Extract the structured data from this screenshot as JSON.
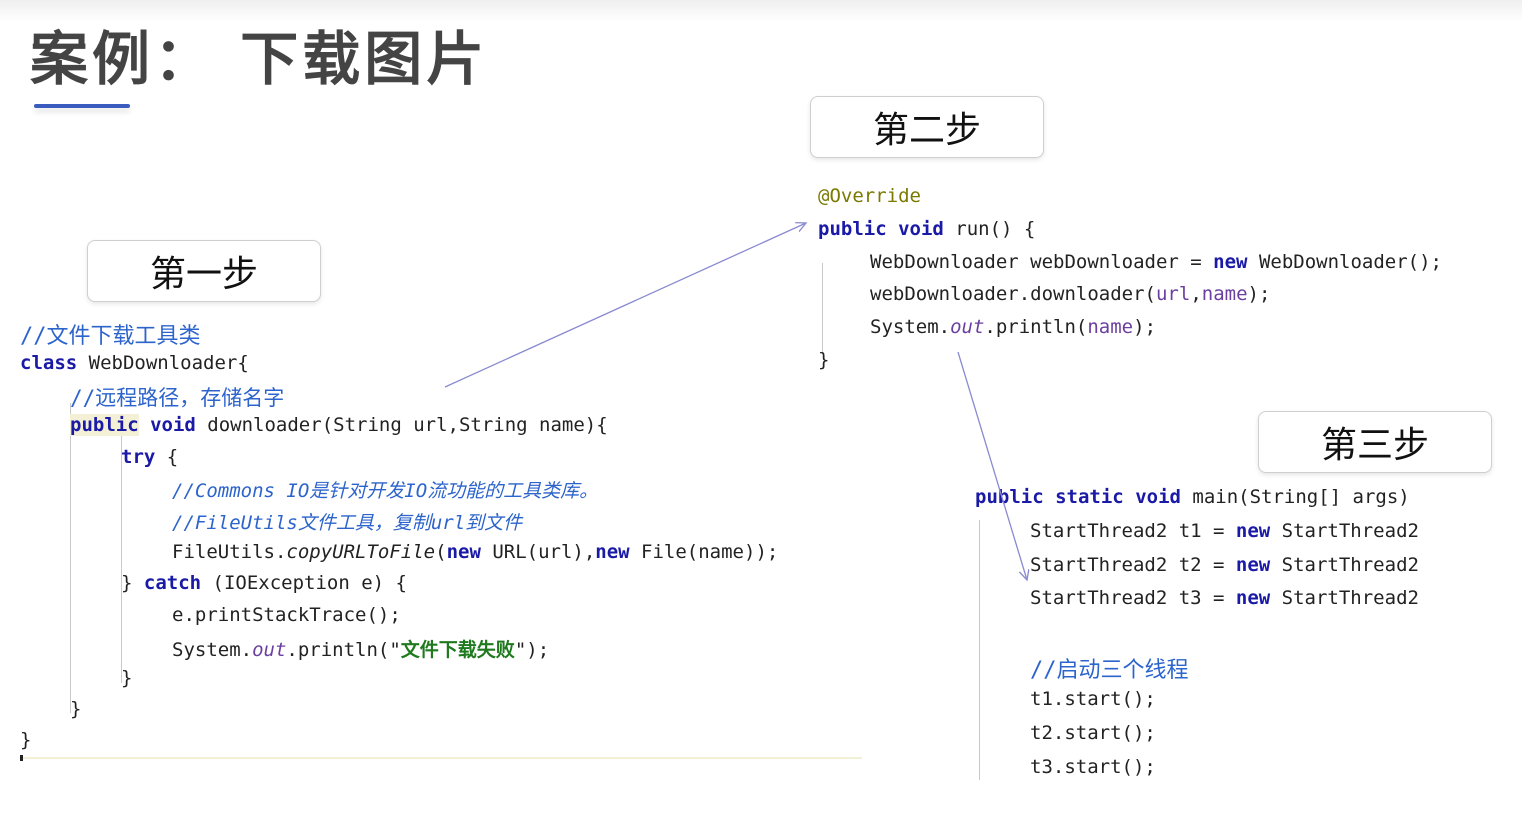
{
  "title": "案例： 下载图片",
  "steps": {
    "step1": "第一步",
    "step2": "第二步",
    "step3": "第三步"
  },
  "code1": {
    "l1": "//文件下载工具类",
    "l2_kw": "class",
    "l2_rest": " WebDownloader{",
    "l3": "//远程路径，存储名字",
    "l4_kw1": "public",
    "l4_kw2": "void",
    "l4_rest": " downloader(String url,String name){",
    "l5_kw": "try",
    "l5_rest": " {",
    "l6": "//Commons IO是针对开发IO流功能的工具类库。",
    "l7": "//FileUtils文件工具，复制url到文件",
    "l8_a": "FileUtils.",
    "l8_b": "copyURLToFile",
    "l8_c": "(",
    "l8_kw1": "new",
    "l8_d": " URL(url),",
    "l8_kw2": "new",
    "l8_e": " File(name));",
    "l9_a": "} ",
    "l9_kw": "catch",
    "l9_b": " (IOException e) {",
    "l10": "e.printStackTrace();",
    "l11_a": "System.",
    "l11_b": "out",
    "l11_c": ".println(\"",
    "l11_str": "文件下载失败",
    "l11_d": "\");",
    "l12": "}",
    "l13": "}",
    "l14": "}"
  },
  "code2": {
    "l1": "@Override",
    "l2_kw1": "public",
    "l2_kw2": "void",
    "l2_rest": " run() {",
    "l3_a": "WebDownloader webDownloader = ",
    "l3_kw": "new",
    "l3_b": " WebDownloader();",
    "l4_a": "webDownloader.downloader(",
    "l4_f1": "url",
    "l4_b": ",",
    "l4_f2": "name",
    "l4_c": ");",
    "l5_a": "System.",
    "l5_b": "out",
    "l5_c": ".println(",
    "l5_f": "name",
    "l5_d": ");",
    "l6": "}"
  },
  "code3": {
    "l1_kw1": "public",
    "l1_kw2": "static",
    "l1_kw3": "void",
    "l1_rest": " main(String[] args)",
    "l2_a": "StartThread2 t1 = ",
    "l2_kw": "new",
    "l2_b": " StartThread2",
    "l3_a": "StartThread2 t2 = ",
    "l3_kw": "new",
    "l3_b": " StartThread2",
    "l4_a": "StartThread2 t3 = ",
    "l4_kw": "new",
    "l4_b": " StartThread2",
    "l5": "//启动三个线程",
    "l6": "t1.start();",
    "l7": "t2.start();",
    "l8": "t3.start();"
  },
  "colors": {
    "keyword": "#1a1aa6",
    "comment": "#2c64cc",
    "string": "#1f7a1f",
    "annotation": "#7a7a00",
    "arrow": "#8a8ad0",
    "title_underline": "#3b5cbf"
  }
}
